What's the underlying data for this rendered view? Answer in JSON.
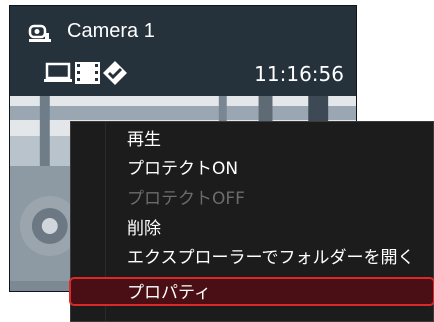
{
  "camera": {
    "title": "Camera 1",
    "time": "11:16:56",
    "icons": [
      "camera-icon",
      "monitor-icon",
      "film-icon",
      "diamond-check-icon"
    ]
  },
  "context_menu": {
    "items": [
      {
        "label": "再生",
        "enabled": true,
        "highlighted": false
      },
      {
        "label": "プロテクトON",
        "enabled": true,
        "highlighted": false
      },
      {
        "label": "プロテクトOFF",
        "enabled": false,
        "highlighted": false
      },
      {
        "label": "削除",
        "enabled": true,
        "highlighted": false
      },
      {
        "label": "エクスプローラーでフォルダーを開く",
        "enabled": true,
        "highlighted": false
      },
      {
        "label": "プロパティ",
        "enabled": true,
        "highlighted": true
      }
    ],
    "highlight_color": "#d92a2a"
  }
}
